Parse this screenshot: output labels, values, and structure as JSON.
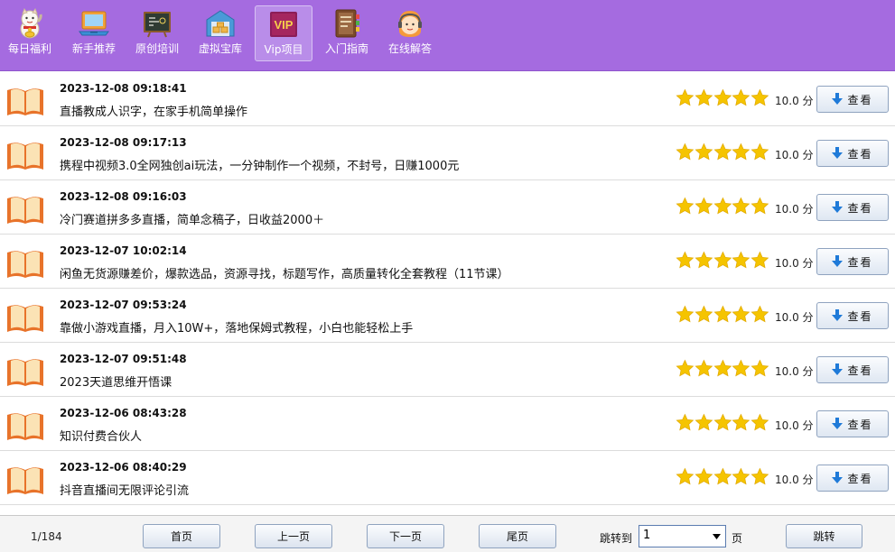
{
  "nav": {
    "items": [
      {
        "label": "每日福利",
        "icon": "lucky-cat-icon"
      },
      {
        "label": "新手推荐",
        "icon": "laptop-icon"
      },
      {
        "label": "原创培训",
        "icon": "blackboard-icon"
      },
      {
        "label": "虚拟宝库",
        "icon": "warehouse-icon"
      },
      {
        "label": "Vip项目",
        "icon": "vip-icon",
        "badge": "VIP",
        "active": true
      },
      {
        "label": "入门指南",
        "icon": "guide-book-icon"
      },
      {
        "label": "在线解答",
        "icon": "support-agent-icon"
      }
    ]
  },
  "list": {
    "view_label": "查看",
    "rows": [
      {
        "time": "2023-12-08 09:18:41",
        "title": "直播教成人识字，在家手机简单操作",
        "score": "10.0 分",
        "stars": 5
      },
      {
        "time": "2023-12-08 09:17:13",
        "title": "携程中视频3.0全网独创ai玩法，一分钟制作一个视频，不封号，日赚1000元",
        "score": "10.0 分",
        "stars": 5
      },
      {
        "time": "2023-12-08 09:16:03",
        "title": "冷门赛道拼多多直播，简单念稿子，日收益2000＋",
        "score": "10.0 分",
        "stars": 5
      },
      {
        "time": "2023-12-07 10:02:14",
        "title": "闲鱼无货源赚差价，爆款选品，资源寻找，标题写作，高质量转化全套教程（11节课）",
        "score": "10.0 分",
        "stars": 5
      },
      {
        "time": "2023-12-07 09:53:24",
        "title": "靠做小游戏直播，月入10W+，落地保姆式教程，小白也能轻松上手",
        "score": "10.0 分",
        "stars": 5
      },
      {
        "time": "2023-12-07 09:51:48",
        "title": "2023天道思维开悟课",
        "score": "10.0 分",
        "stars": 5
      },
      {
        "time": "2023-12-06 08:43:28",
        "title": "知识付费合伙人",
        "score": "10.0 分",
        "stars": 5
      },
      {
        "time": "2023-12-06 08:40:29",
        "title": "抖音直播间无限评论引流",
        "score": "10.0 分",
        "stars": 5
      }
    ]
  },
  "pager": {
    "info": "1/184",
    "first": "首页",
    "prev": "上一页",
    "next": "下一页",
    "last": "尾页",
    "jump_label": "跳转到",
    "jump_value": "1",
    "page_unit": "页",
    "jump_button": "跳转"
  },
  "colors": {
    "nav_bg": "#a56be0",
    "star": "#f5c400",
    "book": "#e8732a"
  }
}
